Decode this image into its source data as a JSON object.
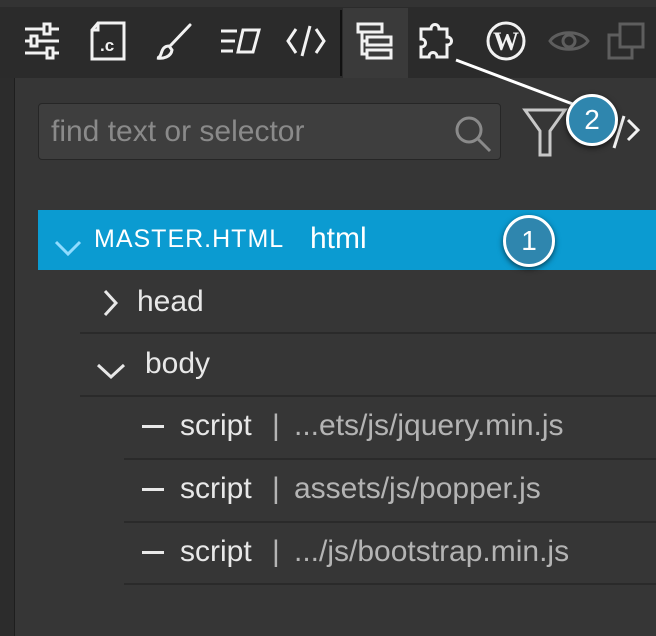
{
  "toolbar": {
    "icons": [
      "settings-sliders-icon",
      "css-file-icon",
      "brush-icon",
      "layout-icon",
      "code-icon",
      "dom-tree-icon",
      "plugins-puzzle-icon",
      "wordpress-icon",
      "eye-icon",
      "duplicate-icon"
    ]
  },
  "search": {
    "placeholder": "find text or selector",
    "value": ""
  },
  "tree": {
    "root": {
      "file_label": "MASTER.HTML",
      "tag": "html",
      "expanded": true
    },
    "nodes": [
      {
        "tag": "head",
        "expanded": false
      },
      {
        "tag": "body",
        "expanded": true
      }
    ],
    "scripts": [
      {
        "tag": "script",
        "sep": "|",
        "src": "...ets/js/jquery.min.js"
      },
      {
        "tag": "script",
        "sep": "|",
        "src": "assets/js/popper.js"
      },
      {
        "tag": "script",
        "sep": "|",
        "src": ".../js/bootstrap.min.js"
      }
    ]
  },
  "callouts": [
    {
      "number": "1"
    },
    {
      "number": "2"
    }
  ],
  "colors": {
    "selection": "#0b9bd1",
    "badge": "#2f86ae",
    "background": "#363636",
    "toolbar": "#2b2b2b"
  }
}
